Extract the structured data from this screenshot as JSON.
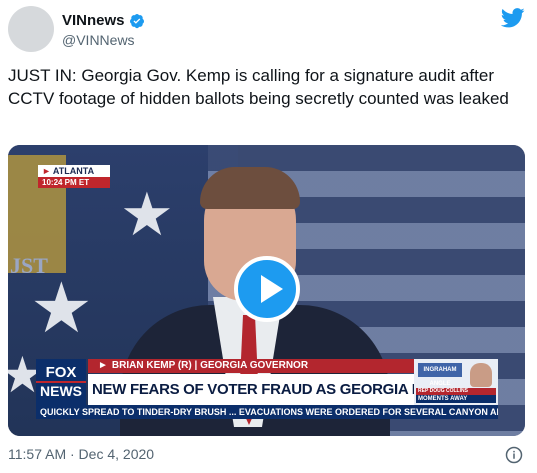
{
  "author": {
    "display_name": "VINnews",
    "handle": "@VINNews",
    "verified": true,
    "verified_icon": "verified-badge-icon",
    "avatar_icon": "avatar"
  },
  "platform_icon": "twitter-bird-icon",
  "tweet": {
    "text": "JUST IN: Georgia Gov. Kemp is calling for a signature audit after CCTV footage of hidden ballots being secretly counted was leaked"
  },
  "video": {
    "location": "ATLANTA",
    "time_stamp": "10:24 PM ET",
    "backdrop_text": "JST",
    "network_line1": "FOX",
    "network_line2": "NEWS",
    "lower_third_name": "BRIAN KEMP (R) | GEORGIA GOVERNOR",
    "headline": "NEW FEARS OF VOTER FRAUD AS GEORGIA RUNOFF NEARS",
    "promo_show": "INGRAHAM ANGLE",
    "promo_rep": "REP DOUG COLLINS",
    "promo_moments": "MOMENTS AWAY",
    "ticker": "QUICKLY SPREAD TO TINDER-DRY BRUSH ...   EVACUATIONS WERE ORDERED FOR SEVERAL CANYON AND F",
    "play_icon": "play-icon"
  },
  "footer": {
    "timestamp": "11:57 AM · Dec 4, 2020",
    "info_icon": "info-icon"
  },
  "colors": {
    "accent": "#1d9bf0",
    "text_primary": "#0f1419",
    "text_secondary": "#536471",
    "fox_blue": "#0b2e6a",
    "fox_red": "#b3262e"
  }
}
